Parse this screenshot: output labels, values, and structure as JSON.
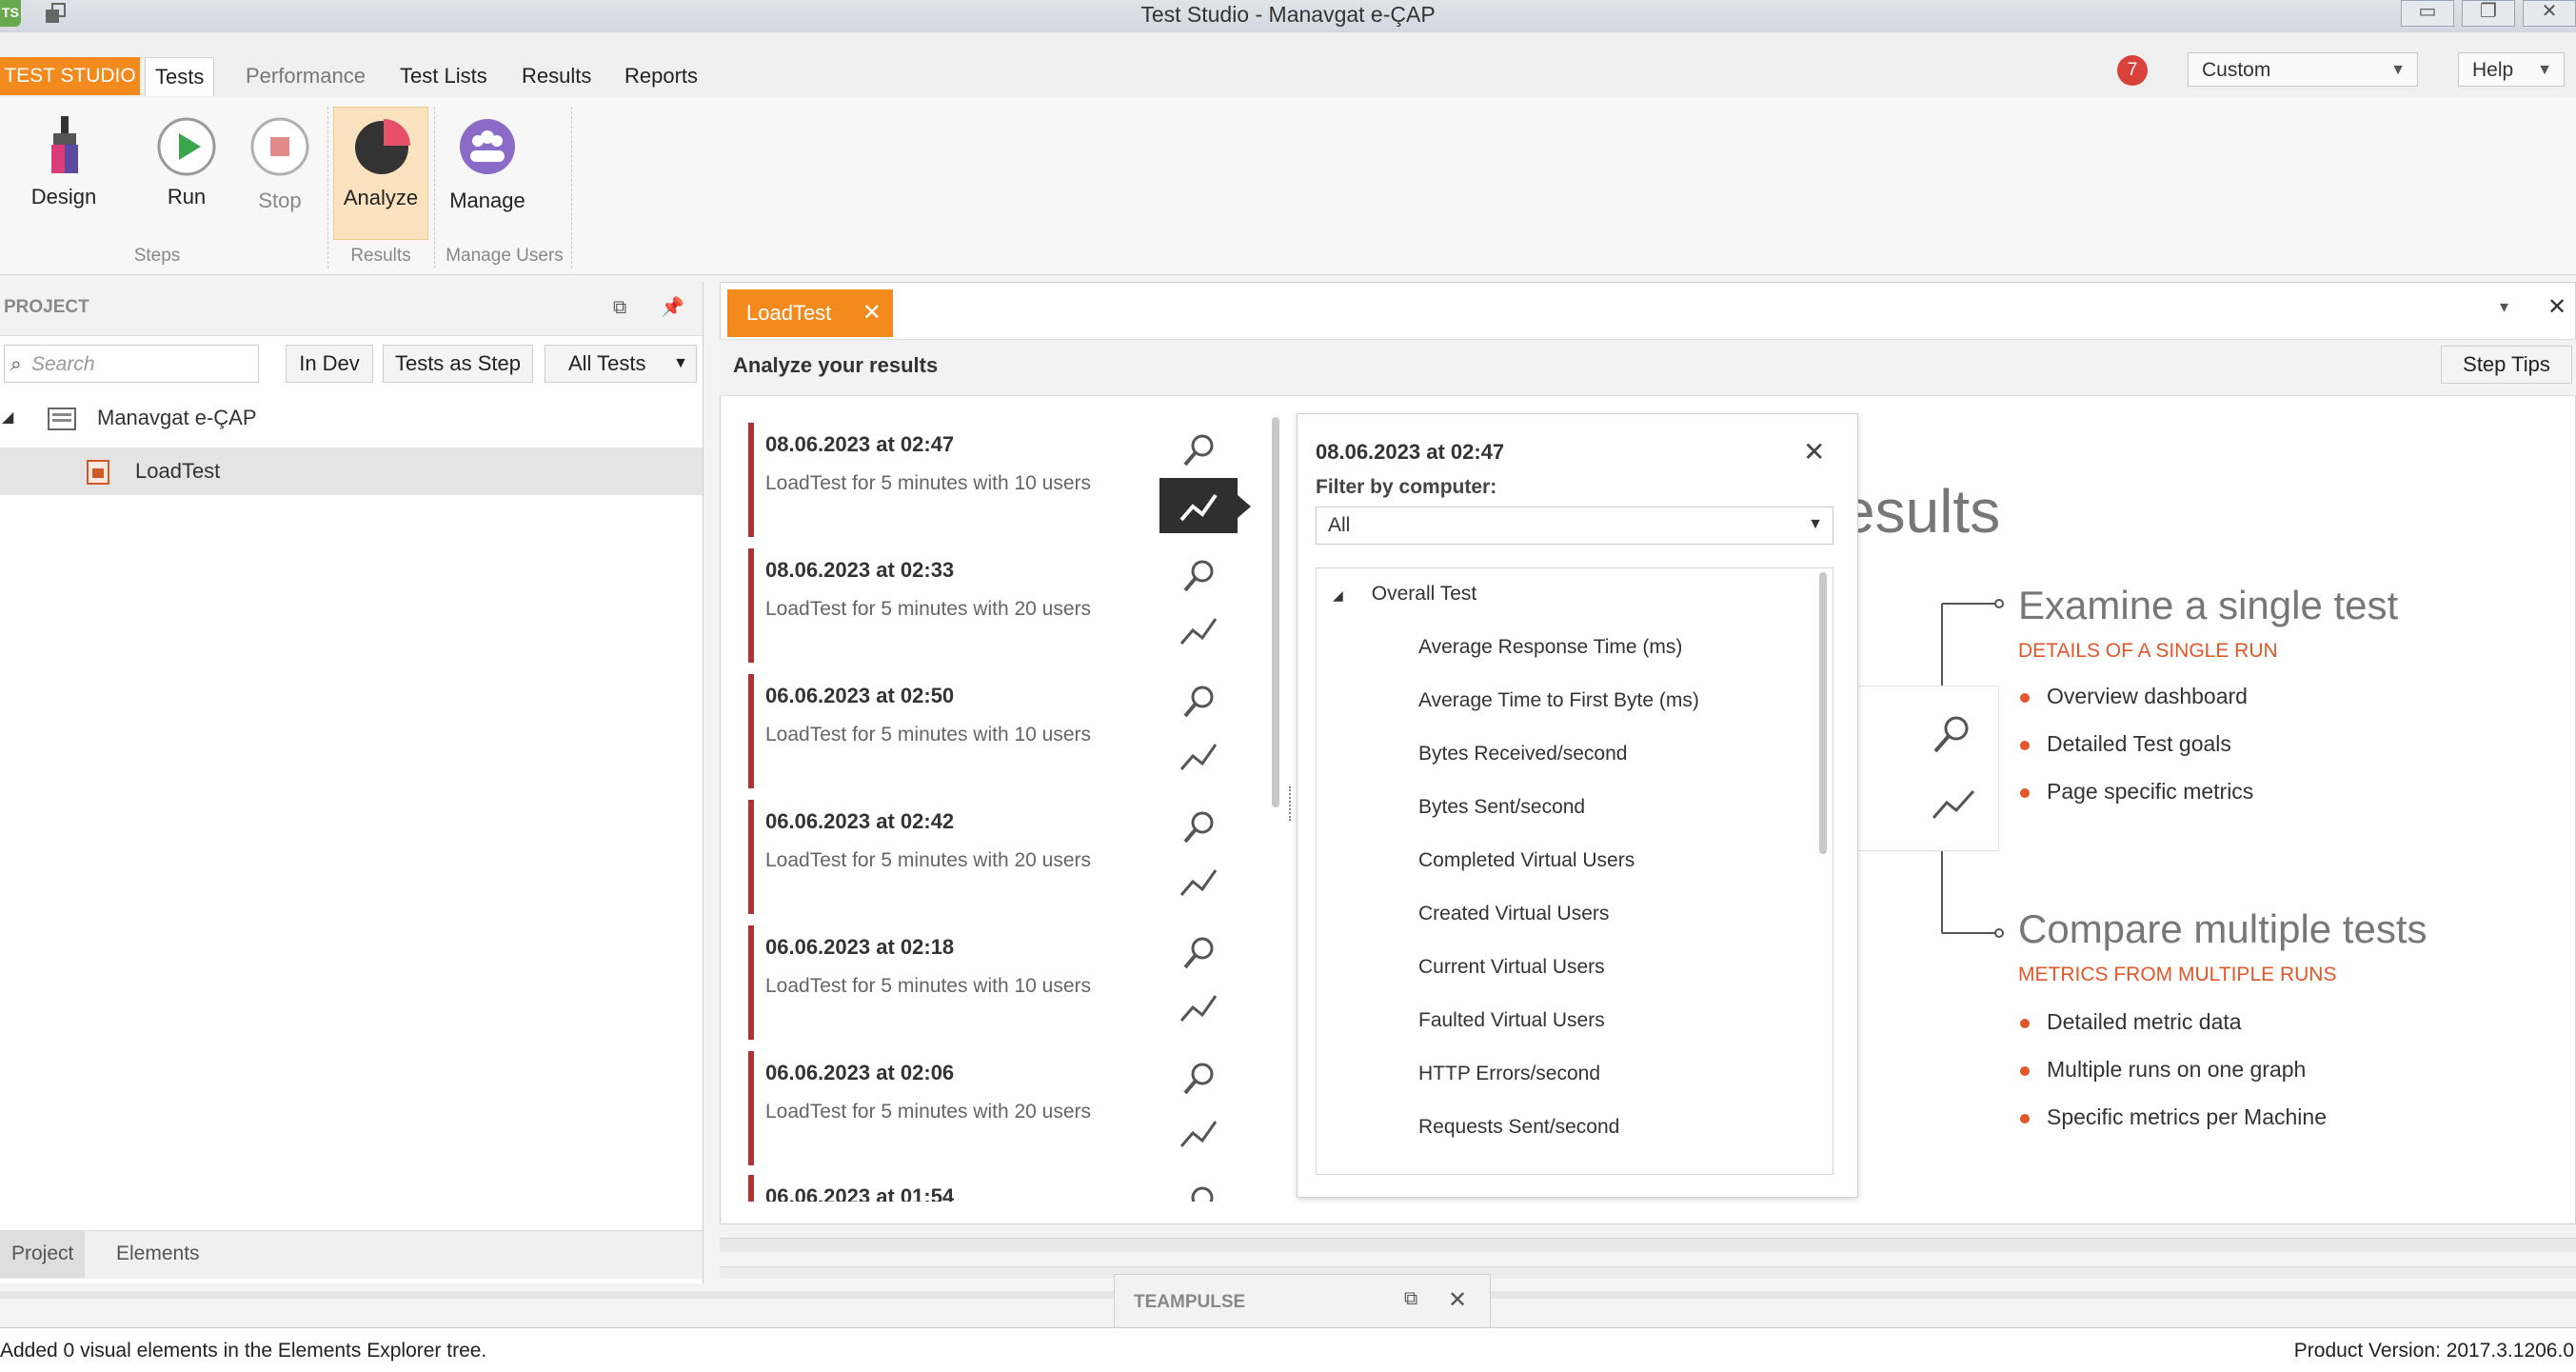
{
  "window": {
    "title": "Test Studio - Manavgat e-ÇAP",
    "app_icon": "TS"
  },
  "ribbon_tabs": {
    "brand": "TEST STUDIO",
    "tabs": [
      "Tests",
      "Performance",
      "Test Lists",
      "Results",
      "Reports"
    ],
    "active": "Tests",
    "notification_count": "7",
    "layout_combo": "Custom",
    "help_label": "Help"
  },
  "ribbon": {
    "design_label": "Design",
    "run_label": "Run",
    "stop_label": "Stop",
    "analyze_label": "Analyze",
    "manage_label": "Manage",
    "group_steps": "Steps",
    "group_results": "Results",
    "group_manage_users": "Manage Users"
  },
  "project_panel": {
    "header": "PROJECT",
    "search_placeholder": "Search",
    "in_dev_label": "In Dev",
    "tests_as_step_label": "Tests as Step",
    "filter_combo": "All Tests",
    "tree": {
      "project": "Manavgat e-ÇAP",
      "test": "LoadTest"
    },
    "bottom_tabs": [
      "Project",
      "Elements"
    ]
  },
  "document": {
    "tab_label": "LoadTest",
    "subheader": "Analyze your results",
    "step_tips_label": "Step Tips",
    "runs": [
      {
        "date": "08.06.2023 at 02:47",
        "summary": "LoadTest for 5 minutes with 10 users"
      },
      {
        "date": "08.06.2023 at 02:33",
        "summary": "LoadTest for 5 minutes with 20 users"
      },
      {
        "date": "06.06.2023 at 02:50",
        "summary": "LoadTest for 5 minutes with 10 users"
      },
      {
        "date": "06.06.2023 at 02:42",
        "summary": "LoadTest for 5 minutes with 20 users"
      },
      {
        "date": "06.06.2023 at 02:18",
        "summary": "LoadTest for 5 minutes with 10 users"
      },
      {
        "date": "06.06.2023 at 02:06",
        "summary": "LoadTest for 5 minutes with 20 users"
      },
      {
        "date": "06.06.2023 at 01:54",
        "summary": ""
      }
    ]
  },
  "popup": {
    "title": "08.06.2023 at 02:47",
    "filter_label": "Filter by computer:",
    "filter_value": "All",
    "tree_root": "Overall Test",
    "metrics": [
      "Average Response Time (ms)",
      "Average Time to First Byte (ms)",
      "Bytes Received/second",
      "Bytes Sent/second",
      "Completed Virtual Users",
      "Created Virtual Users",
      "Current Virtual Users",
      "Faulted Virtual Users",
      "HTTP Errors/second",
      "Requests Sent/second"
    ]
  },
  "info": {
    "partial_heading": "esults",
    "single": {
      "title": "Examine a single test",
      "subtitle": "DETAILS OF A SINGLE RUN",
      "bullets": [
        "Overview dashboard",
        "Detailed Test goals",
        "Page specific metrics"
      ]
    },
    "multiple": {
      "title": "Compare multiple tests",
      "subtitle": "METRICS FROM MULTIPLE RUNS",
      "bullets": [
        "Detailed metric data",
        "Multiple runs on one graph",
        "Specific metrics per Machine"
      ]
    }
  },
  "teampulse": {
    "label": "TEAMPULSE"
  },
  "status": {
    "message": "Added 0 visual elements in the Elements Explorer tree.",
    "version": "Product Version: 2017.3.1206.0"
  },
  "colors": {
    "accent": "#f28a1d",
    "run_bar": "#b03333",
    "info_orange": "#e1572a"
  }
}
